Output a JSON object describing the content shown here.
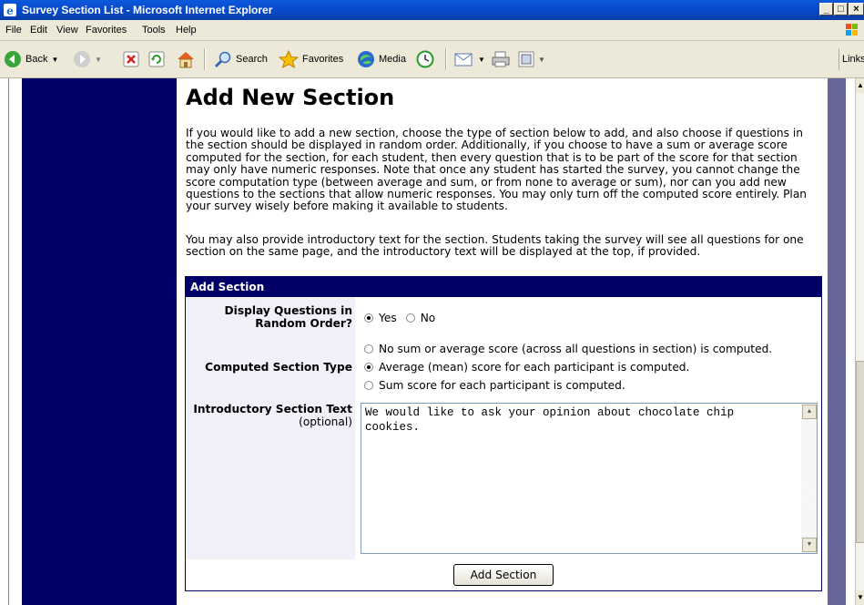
{
  "window": {
    "title": "Survey Section List - Microsoft Internet Explorer",
    "controls": [
      "_",
      "□",
      "×"
    ]
  },
  "menu": [
    "File",
    "Edit",
    "View",
    "Favorites",
    "Tools",
    "Help"
  ],
  "toolbar": {
    "back": "Back",
    "search": "Search",
    "favorites": "Favorites",
    "media": "Media",
    "links": "Links"
  },
  "page": {
    "heading": "Add New Section",
    "intro": "If you would like to add a new section, choose the type of section below to add, and also choose if questions in the section should be displayed in random order. Additionally, if you choose to have a sum or average score computed for the section, for each student, then every question that is to be part of the score for that section may only have numeric responses. Note that once any student has started the survey, you cannot change the score computation type (between average and sum, or from none to average or sum), nor can you add new questions to the sections that allow numeric responses. You may only turn off the computed score entirely. Plan your survey wisely before making it available to students.",
    "intro2": "You may also provide introductory text for the section. Students taking the survey will see all questions for one section on the same page, and the introductory text will be displayed at the top, if provided."
  },
  "form": {
    "title": "Add Section",
    "random_label": "Display Questions in Random Order?",
    "random_options": [
      {
        "label": "Yes",
        "selected": true
      },
      {
        "label": "No",
        "selected": false
      }
    ],
    "computed_label": "Computed Section Type",
    "computed_options": [
      {
        "label": "No sum or average score (across all questions in section) is computed.",
        "selected": false
      },
      {
        "label": "Average (mean) score for each participant is computed.",
        "selected": true
      },
      {
        "label": "Sum score for each participant is computed.",
        "selected": false
      }
    ],
    "intro_label": "Introductory Section Text",
    "intro_optional": "(optional)",
    "intro_value": "We would like to ask your opinion about chocolate chip cookies.",
    "submit": "Add Section"
  },
  "colors": {
    "navy": "#000066",
    "sidebar_right": "#666699",
    "titlebar": "#0a58dc"
  }
}
